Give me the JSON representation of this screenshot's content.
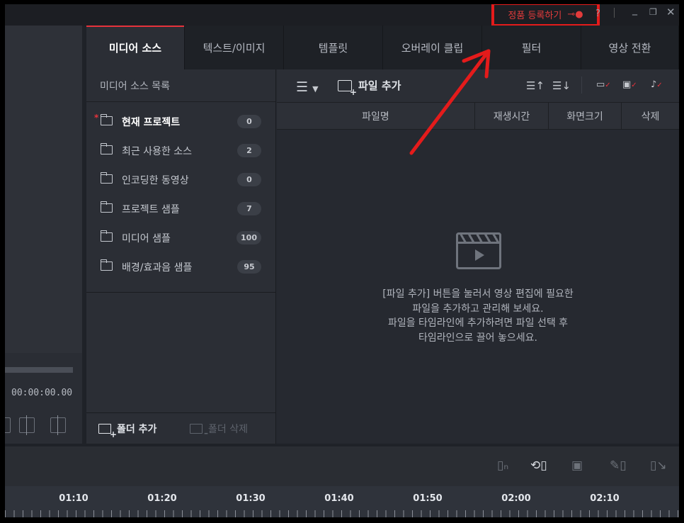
{
  "titlebar": {
    "register_label": "정품 등록하기",
    "key_icon": "key-icon",
    "controls": [
      "help-icon",
      "minimize-icon",
      "restore-icon",
      "close-icon"
    ]
  },
  "preview": {
    "timecode": "00:00:00.00"
  },
  "tabs": [
    {
      "label": "미디어 소스",
      "active": true
    },
    {
      "label": "텍스트/이미지",
      "active": false
    },
    {
      "label": "템플릿",
      "active": false
    },
    {
      "label": "오버레이 클립",
      "active": false
    },
    {
      "label": "필터",
      "active": false
    },
    {
      "label": "영상 전환",
      "active": false
    }
  ],
  "sidebar": {
    "header": "미디어 소스 목록",
    "folders": [
      {
        "label": "현재 프로젝트",
        "count": "0",
        "active": true
      },
      {
        "label": "최근 사용한 소스",
        "count": "2",
        "active": false
      },
      {
        "label": "인코딩한 동영상",
        "count": "0",
        "active": false
      },
      {
        "label": "프로젝트 샘플",
        "count": "7",
        "active": false
      },
      {
        "label": "미디어 샘플",
        "count": "100",
        "active": false
      },
      {
        "label": "배경/효과음 샘플",
        "count": "95",
        "active": false
      }
    ],
    "add_folder": "폴더 추가",
    "delete_folder": "폴더 삭제"
  },
  "files": {
    "add_file": "파일 추가",
    "columns": {
      "name": "파일명",
      "duration": "재생시간",
      "size": "화면크기",
      "delete": "삭제"
    },
    "empty_lines": [
      "[파일 추가] 버튼을 눌러서 영상 편집에 필요한",
      "파일을 추가하고 관리해 보세요.",
      "파일을 타임라인에 추가하려면 파일 선택 후",
      "타임라인으로 끌어 놓으세요."
    ]
  },
  "timeline": {
    "ticks": [
      "01:10",
      "01:20",
      "01:30",
      "01:40",
      "01:50",
      "02:00",
      "02:10"
    ]
  },
  "colors": {
    "accent": "#e6323b",
    "annotation": "#e41b1b",
    "background": "#1f2228"
  }
}
